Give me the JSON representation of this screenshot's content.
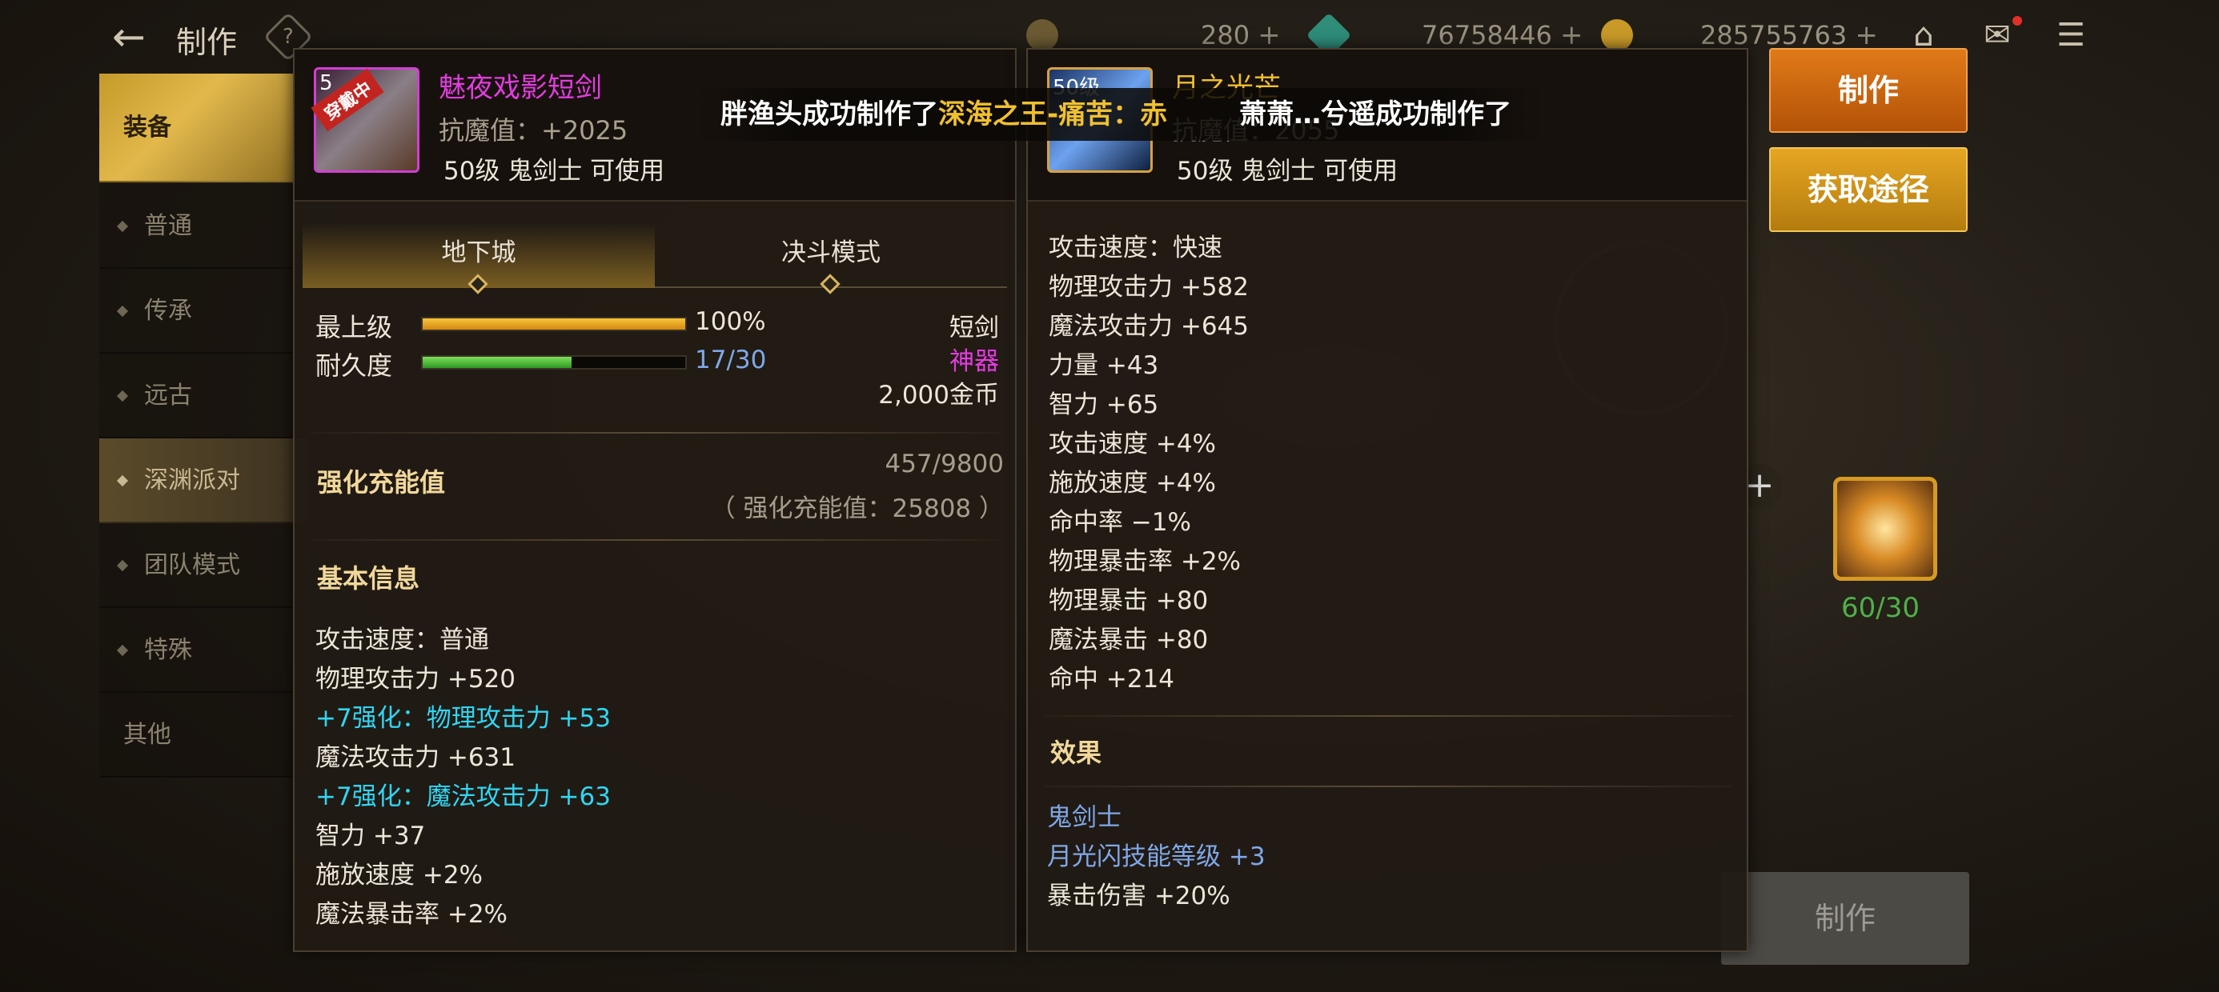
{
  "topbar": {
    "title": "制作",
    "help_glyph": "?",
    "resource_1": "280",
    "resource_2": "76758446",
    "resource_3": "285755763",
    "plus": "+"
  },
  "sidebar": {
    "items": [
      {
        "label": "装备"
      },
      {
        "label": "普通"
      },
      {
        "label": "传承"
      },
      {
        "label": "远古"
      },
      {
        "label": "深渊派对"
      },
      {
        "label": "团队模式"
      },
      {
        "label": "特殊"
      },
      {
        "label": "其他"
      }
    ]
  },
  "buttons": {
    "craft": "制作",
    "acquire": "获取途径",
    "craft_bottom": "制作"
  },
  "material": {
    "count": "60/30"
  },
  "broadcast": {
    "part1": "胖渔头成功制作了",
    "part2": "深海之王-痛苦：赤",
    "part3": "萧萧…兮遥成功制作了"
  },
  "left_item": {
    "badge": "穿戴中",
    "level_prefix": "5",
    "name": "魅夜戏影短剑",
    "magic_resist": "抗魔值：+2025",
    "usable": "50级 鬼剑士 可使用",
    "tabs": [
      "地下城",
      "决斗模式"
    ],
    "grade_label": "最上级",
    "grade_value": "100%",
    "grade_fraction": 1.0,
    "durability_label": "耐久度",
    "durability_value": "17/30",
    "durability_fraction": 0.567,
    "type": "短剑",
    "rarity": "神器",
    "price": "2,000金币",
    "charge_label": "强化充能值",
    "charge_value": "457/9800",
    "charge_total": "（ 强化充能值：25808 ）",
    "basic_info_title": "基本信息",
    "stats": [
      {
        "text": "攻击速度：普通",
        "style": "normal"
      },
      {
        "text": "物理攻击力 +520",
        "style": "normal"
      },
      {
        "text": "+7强化：物理攻击力 +53",
        "style": "cyan"
      },
      {
        "text": "魔法攻击力 +631",
        "style": "normal"
      },
      {
        "text": "+7强化：魔法攻击力 +63",
        "style": "cyan"
      },
      {
        "text": "智力 +37",
        "style": "normal"
      },
      {
        "text": "施放速度 +2%",
        "style": "normal"
      },
      {
        "text": "魔法暴击率 +2%",
        "style": "normal"
      }
    ]
  },
  "right_item": {
    "level_badge": "50级",
    "name": "月之光芒",
    "magic_resist": "抗魔值：2055",
    "usable": "50级 鬼剑士 可使用",
    "stats": [
      "攻击速度：快速",
      "物理攻击力 +582",
      "魔法攻击力 +645",
      "力量 +43",
      "智力 +65",
      "攻击速度 +4%",
      "施放速度 +4%",
      "命中率 −1%",
      "物理暴击率 +2%",
      "物理暴击 +80",
      "魔法暴击 +80",
      "命中 +214"
    ],
    "effect_title": "效果",
    "effects": [
      {
        "text": "鬼剑士",
        "style": "blue"
      },
      {
        "text": "月光闪技能等级 +3",
        "style": "blue"
      },
      {
        "text": "暴击伤害 +20%",
        "style": "normal"
      }
    ]
  },
  "colors": {
    "accent_gold": "#f0c030",
    "legendary_magenta": "#e33ce0",
    "enhance_cyan": "#2fd6f2",
    "craft_orange": "#e07a18"
  }
}
